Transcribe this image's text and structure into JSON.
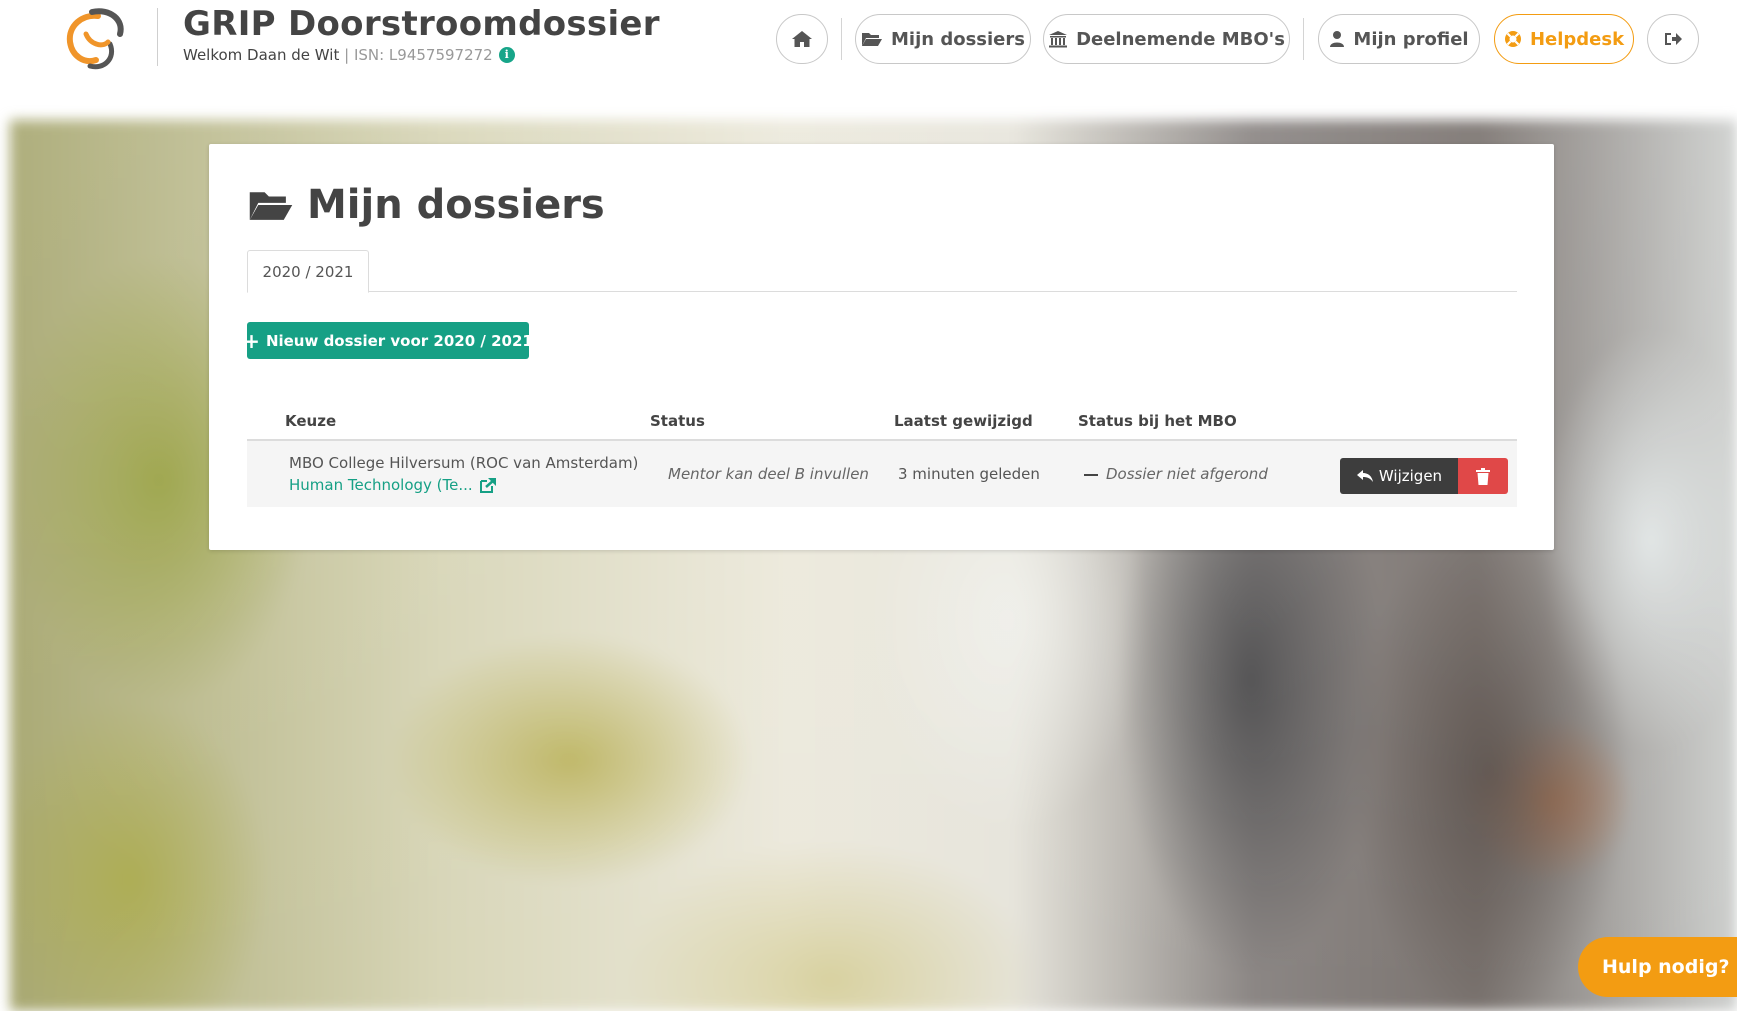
{
  "header": {
    "title": "GRIP Doorstroomdossier",
    "welcome": "Welkom Daan de Wit",
    "separator": " | ",
    "isn": "ISN: L9457597272",
    "info_icon": "info-circle-icon"
  },
  "nav": {
    "home_icon": "home-icon",
    "mijn_dossiers": "Mijn dossiers",
    "deelnemende": "Deelnemende MBO's",
    "profiel": "Mijn profiel",
    "helpdesk": "Helpdesk",
    "logout_icon": "sign-out-icon"
  },
  "main": {
    "title": "Mijn dossiers",
    "tabs": [
      {
        "label": "2020 / 2021"
      }
    ],
    "new_button": "Nieuw dossier voor 2020 / 2021",
    "table": {
      "headers": [
        "Keuze",
        "Status",
        "Laatst gewijzigd",
        "Status bij het MBO"
      ],
      "rows": [
        {
          "school": "MBO College Hilversum (ROC van Amsterdam)",
          "program": "Human Technology (Te...",
          "status": "Mentor kan deel B invullen",
          "modified": "3 minuten geleden",
          "mbo_status": "Dossier niet afgerond",
          "edit_label": "Wijzigen"
        }
      ]
    }
  },
  "help_float": "Hulp nodig?",
  "colors": {
    "accent_green": "#16a085",
    "accent_orange": "#f39c12",
    "danger_red": "#e04848",
    "dark_button": "#3d3d3d"
  }
}
